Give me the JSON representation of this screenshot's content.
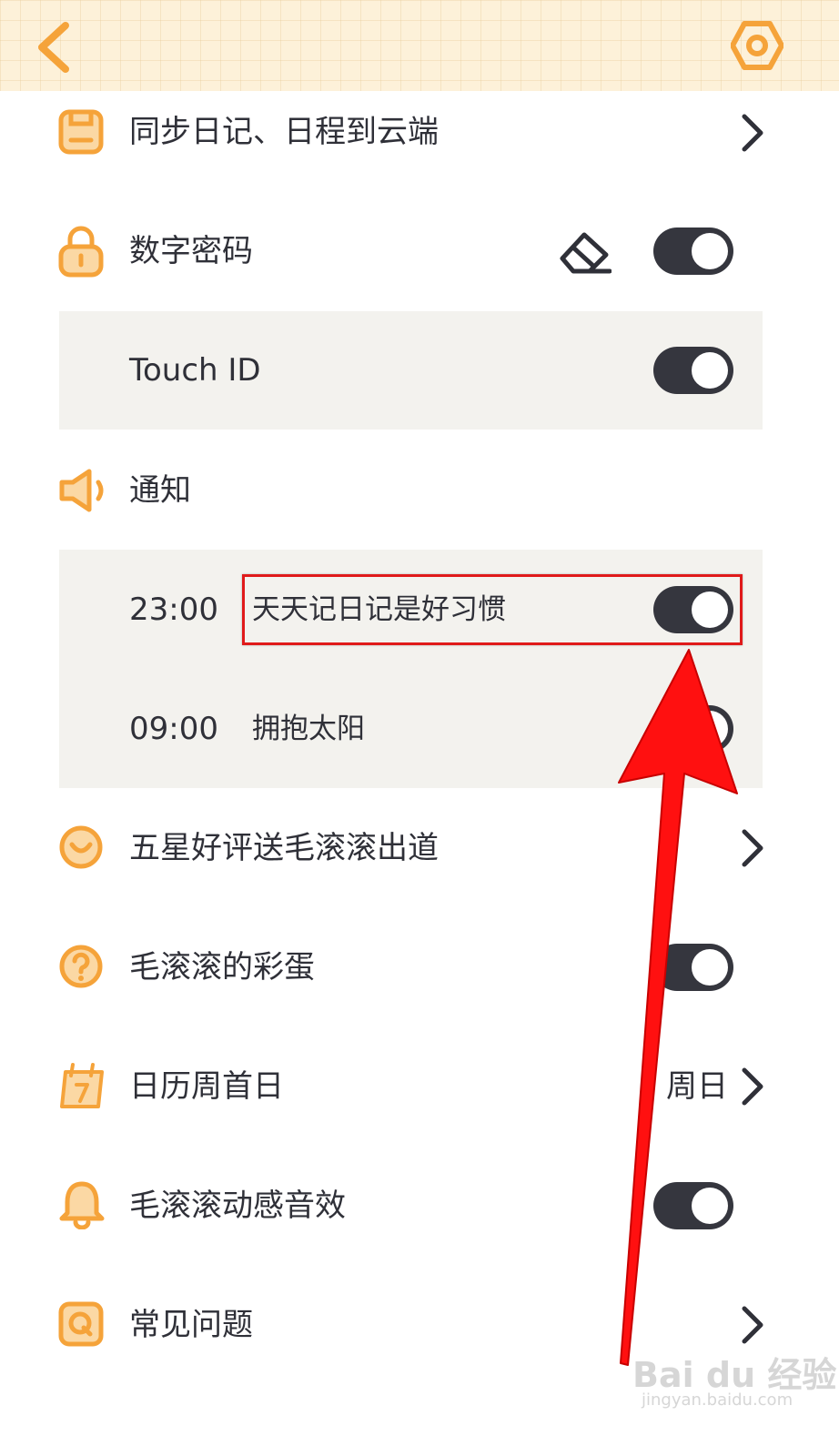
{
  "colors": {
    "accent": "#f5a33a",
    "toggle": "#35363e",
    "highlight": "#e01a1a",
    "arrow": "#ff1010"
  },
  "settings": {
    "sync": {
      "label": "同步日记、日程到云端",
      "icon": "save-disk-icon"
    },
    "passcode": {
      "label": "数字密码",
      "icon": "lock-icon",
      "clear_icon": "eraser-icon",
      "enabled": true
    },
    "touch_id": {
      "label": "Touch ID",
      "enabled": true
    },
    "notifications": {
      "label": "通知",
      "icon": "speaker-icon",
      "items": [
        {
          "time": "23:00",
          "text": "天天记日记是好习惯",
          "enabled": true
        },
        {
          "time": "09:00",
          "text": "拥抱太阳",
          "enabled": true
        }
      ]
    },
    "rating": {
      "label": "五星好评送毛滚滚出道",
      "icon": "smile-icon"
    },
    "easter_egg": {
      "label": "毛滚滚的彩蛋",
      "icon": "question-icon",
      "enabled": true
    },
    "week_start": {
      "label": "日历周首日",
      "value": "周日",
      "icon": "calendar-icon"
    },
    "sound": {
      "label": "毛滚滚动感音效",
      "icon": "bell-icon",
      "enabled": true
    },
    "faq": {
      "label": "常见问题",
      "icon": "q-icon"
    }
  },
  "watermark": {
    "brand": "Bai du 经验",
    "url": "jingyan.baidu.com"
  }
}
